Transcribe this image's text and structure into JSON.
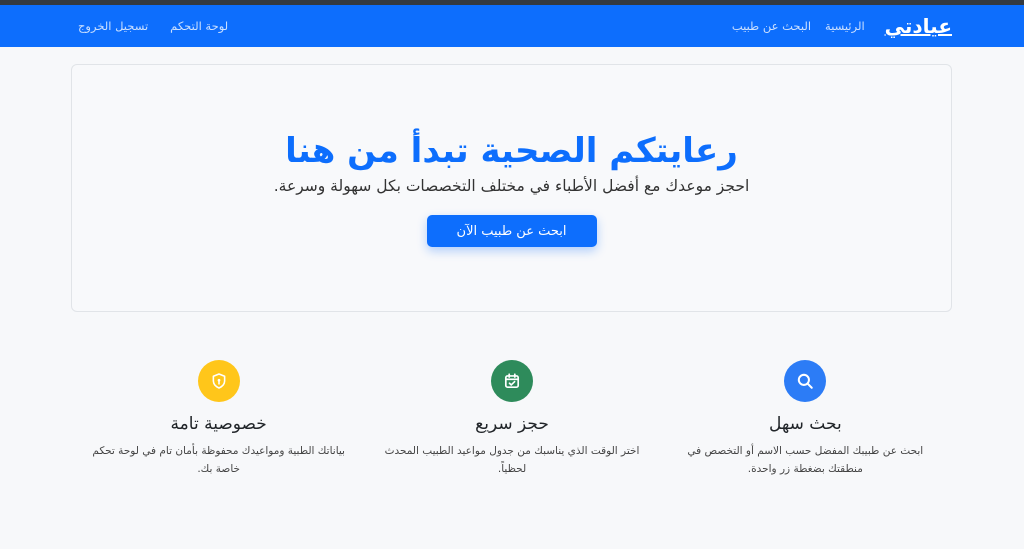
{
  "navbar": {
    "brand": "عيادتي",
    "links": [
      "الرئيسية",
      "البحث عن طبيب"
    ],
    "left_links": [
      "لوحة التحكم",
      "تسجيل الخروج"
    ],
    "color": "#0d6efd"
  },
  "hero": {
    "title": "رعايتكم الصحية تبدأ من هنا",
    "subtitle": "احجز موعدك مع أفضل الأطباء في مختلف التخصصات بكل سهولة وسرعة.",
    "button": "ابحث عن طبيب الآن"
  },
  "features": [
    {
      "icon": "search-icon",
      "color": "#0d6efd",
      "title": "بحث سهل",
      "desc": "ابحث عن طبيبك المفضل حسب الاسم أو التخصص في منطقتك بضغطة زر واحدة."
    },
    {
      "icon": "calendar-check-icon",
      "color": "#198754",
      "title": "حجز سريع",
      "desc": "اختر الوقت الذي يناسبك من جدول مواعيد الطبيب المحدث لحظياً."
    },
    {
      "icon": "shield-lock-icon",
      "color": "#ffc107",
      "title": "خصوصية تامة",
      "desc": "بياناتك الطبية ومواعيدك محفوظة بأمان تام في لوحة تحكم خاصة بك."
    }
  ]
}
